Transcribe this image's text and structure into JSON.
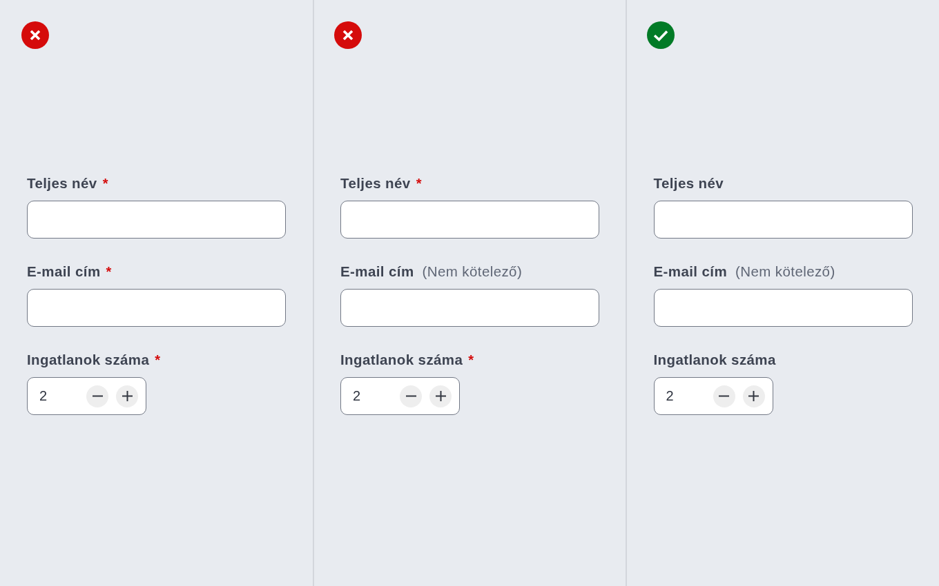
{
  "panels": [
    {
      "kind": "error",
      "fields": [
        {
          "kind": "text",
          "label": "Teljes név",
          "marker": "*"
        },
        {
          "kind": "text",
          "label": "E-mail cím",
          "marker": "*"
        },
        {
          "kind": "stepper",
          "label": "Ingatlanok száma",
          "marker": "*",
          "value": "2"
        }
      ]
    },
    {
      "kind": "error",
      "fields": [
        {
          "kind": "text",
          "label": "Teljes név",
          "marker": "*"
        },
        {
          "kind": "text",
          "label": "E-mail cím",
          "note": "(Nem kötelező)"
        },
        {
          "kind": "stepper",
          "label": "Ingatlanok száma",
          "marker": "*",
          "value": "2"
        }
      ]
    },
    {
      "kind": "success",
      "fields": [
        {
          "kind": "text",
          "label": "Teljes név"
        },
        {
          "kind": "text",
          "label": "E-mail cím",
          "note": "(Nem kötelező)"
        },
        {
          "kind": "stepper",
          "label": "Ingatlanok száma",
          "value": "2"
        }
      ]
    }
  ]
}
